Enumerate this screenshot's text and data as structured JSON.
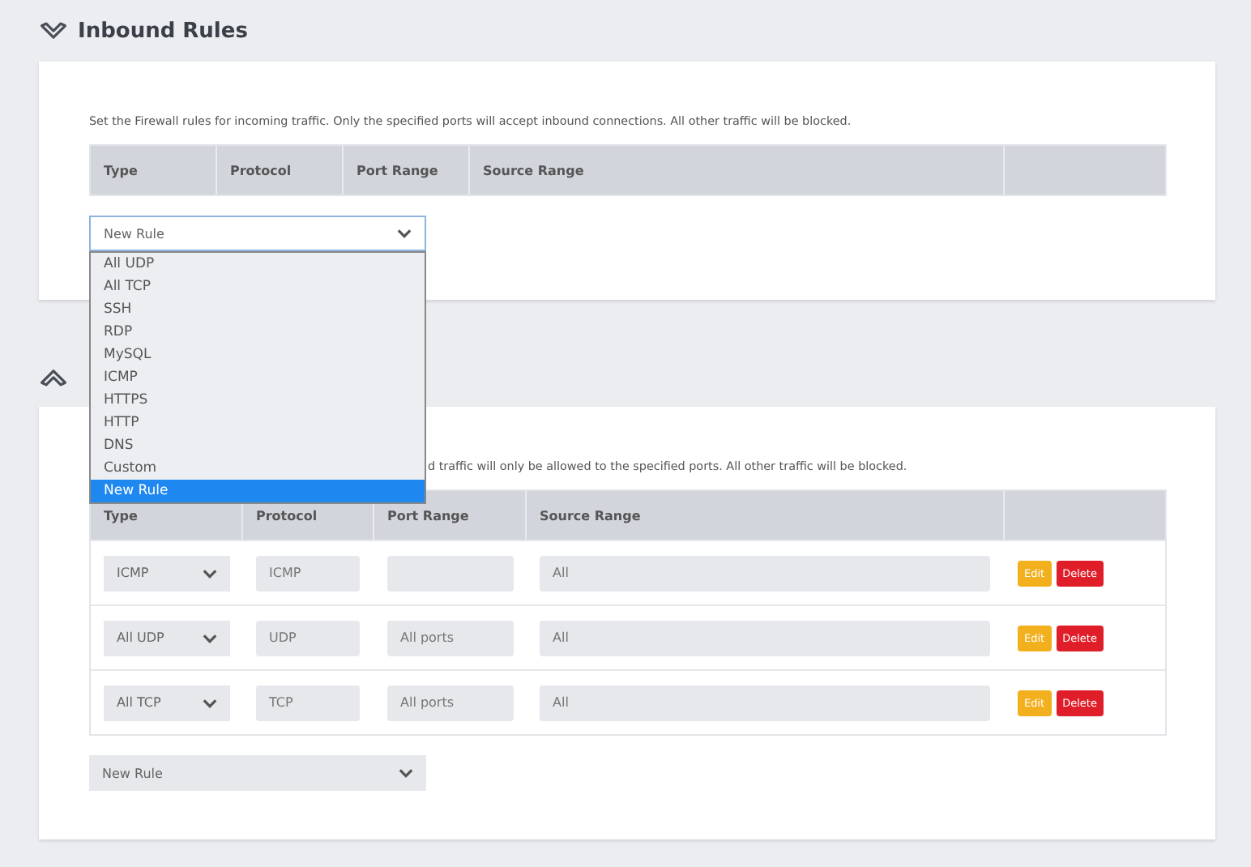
{
  "sections": [
    {
      "title": "Inbound Rules",
      "kind": "down",
      "description": "Set the Firewall rules for incoming traffic. Only the specified ports will accept inbound connections. All other traffic will be blocked.",
      "columns": [
        "Type",
        "Protocol",
        "Port Range",
        "Source Range"
      ],
      "new_rule_select": {
        "value": "New Rule",
        "open": true,
        "options": [
          {
            "label": "All UDP",
            "selected": false
          },
          {
            "label": "All TCP",
            "selected": false
          },
          {
            "label": "SSH",
            "selected": false
          },
          {
            "label": "RDP",
            "selected": false
          },
          {
            "label": "MySQL",
            "selected": false
          },
          {
            "label": "ICMP",
            "selected": false
          },
          {
            "label": "HTTPS",
            "selected": false
          },
          {
            "label": "HTTP",
            "selected": false
          },
          {
            "label": "DNS",
            "selected": false
          },
          {
            "label": "Custom",
            "selected": false
          },
          {
            "label": "New Rule",
            "selected": true
          }
        ]
      }
    },
    {
      "kind": "up",
      "description": "d traffic will only be allowed to the specified ports. All other traffic will be blocked.",
      "columns": [
        "Type",
        "Protocol",
        "Port Range",
        "Source Range"
      ],
      "rules": [
        {
          "type": "ICMP",
          "protocol": "ICMP",
          "source_range": "All",
          "edit_label": "Edit",
          "delete_label": "Delete"
        },
        {
          "type": "All UDP",
          "protocol": "UDP",
          "port_range": "All ports",
          "source_range": "All",
          "edit_label": "Edit",
          "delete_label": "Delete"
        },
        {
          "type": "All TCP",
          "protocol": "TCP",
          "port_range": "All ports",
          "source_range": "All",
          "edit_label": "Edit",
          "delete_label": "Delete"
        }
      ],
      "new_rule_select": {
        "value": "New Rule",
        "open": false
      }
    }
  ]
}
